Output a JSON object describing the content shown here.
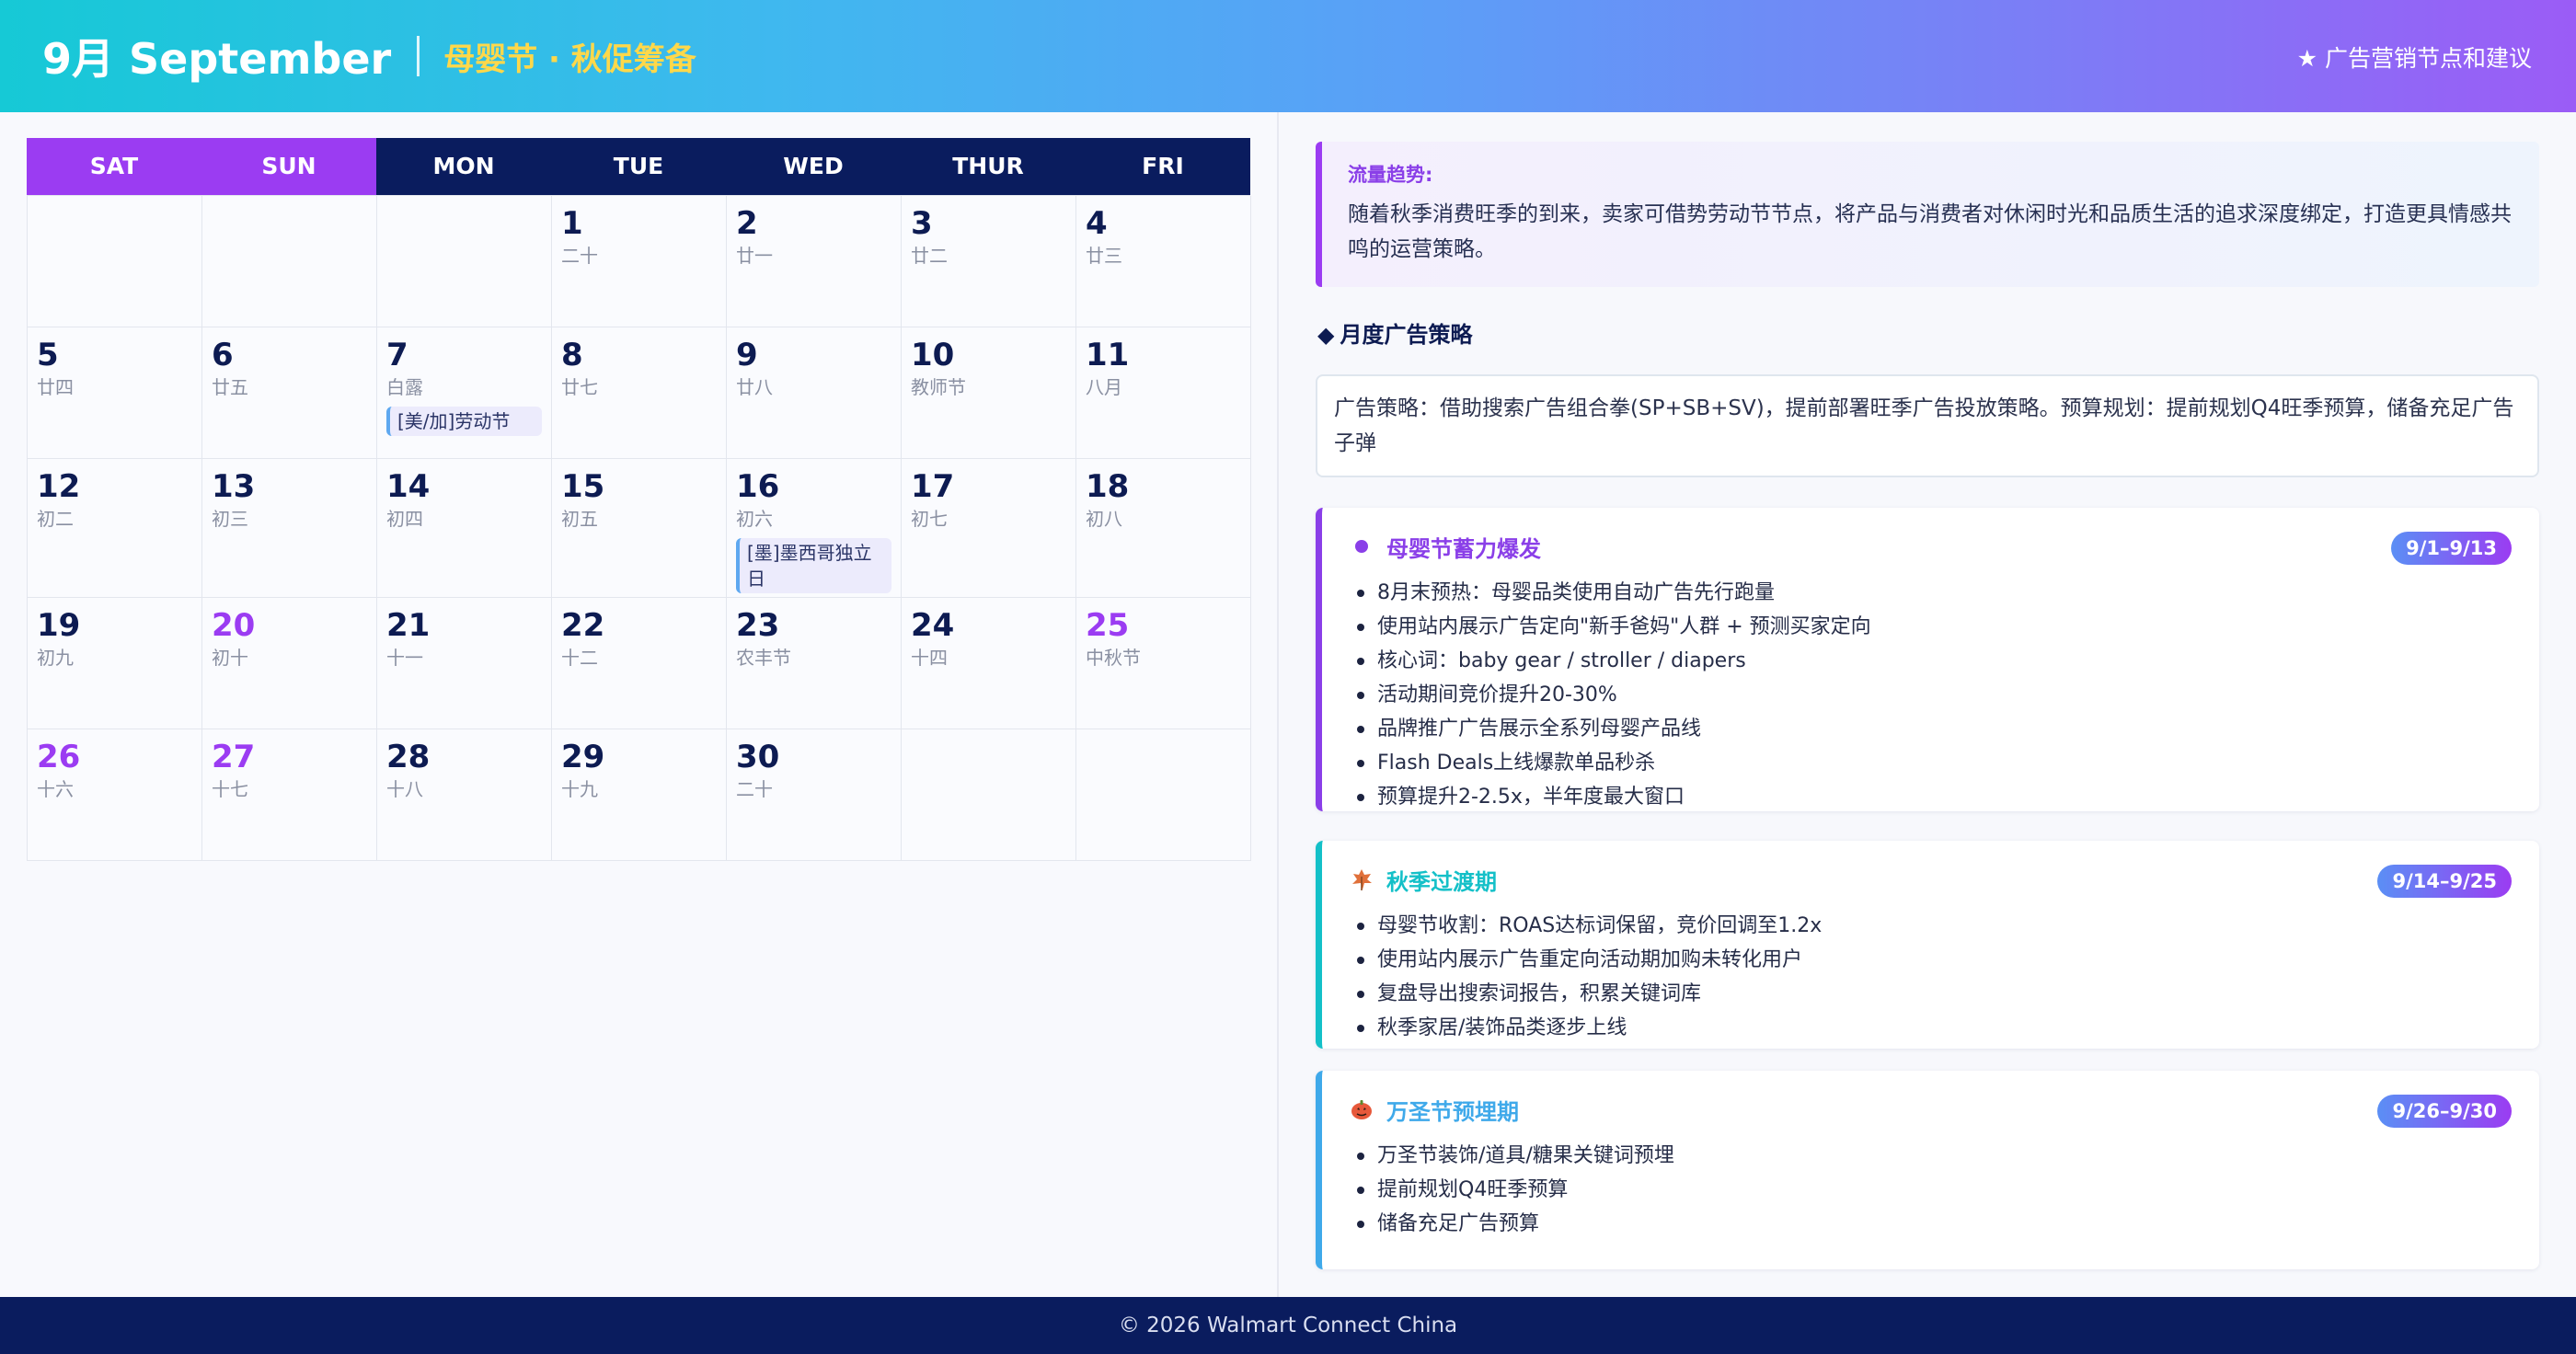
{
  "header": {
    "month": "9月 September",
    "theme": "母婴节 · 秋促筹备",
    "right_label": "★ 广告营销节点和建议"
  },
  "calendar": {
    "weekdays": [
      "SAT",
      "SUN",
      "MON",
      "TUE",
      "WED",
      "THUR",
      "FRI"
    ],
    "weeks": [
      [
        {
          "day": "",
          "lunar": ""
        },
        {
          "day": "",
          "lunar": ""
        },
        {
          "day": "",
          "lunar": ""
        },
        {
          "day": "1",
          "lunar": "二十"
        },
        {
          "day": "2",
          "lunar": "廿一"
        },
        {
          "day": "3",
          "lunar": "廿二"
        },
        {
          "day": "4",
          "lunar": "廿三"
        }
      ],
      [
        {
          "day": "5",
          "lunar": "廿四"
        },
        {
          "day": "6",
          "lunar": "廿五"
        },
        {
          "day": "7",
          "lunar": "白露",
          "event": "[美/加]劳动节"
        },
        {
          "day": "8",
          "lunar": "廿七"
        },
        {
          "day": "9",
          "lunar": "廿八"
        },
        {
          "day": "10",
          "lunar": "教师节"
        },
        {
          "day": "11",
          "lunar": "八月"
        }
      ],
      [
        {
          "day": "12",
          "lunar": "初二"
        },
        {
          "day": "13",
          "lunar": "初三"
        },
        {
          "day": "14",
          "lunar": "初四"
        },
        {
          "day": "15",
          "lunar": "初五"
        },
        {
          "day": "16",
          "lunar": "初六",
          "event": "[墨]墨西哥独立日"
        },
        {
          "day": "17",
          "lunar": "初七"
        },
        {
          "day": "18",
          "lunar": "初八"
        }
      ],
      [
        {
          "day": "19",
          "lunar": "初九"
        },
        {
          "day": "20",
          "lunar": "初十",
          "highlight": true
        },
        {
          "day": "21",
          "lunar": "十一"
        },
        {
          "day": "22",
          "lunar": "十二"
        },
        {
          "day": "23",
          "lunar": "农丰节"
        },
        {
          "day": "24",
          "lunar": "十四"
        },
        {
          "day": "25",
          "lunar": "中秋节",
          "highlight": true
        }
      ],
      [
        {
          "day": "26",
          "lunar": "十六",
          "highlight": true
        },
        {
          "day": "27",
          "lunar": "十七",
          "highlight": true
        },
        {
          "day": "28",
          "lunar": "十八"
        },
        {
          "day": "29",
          "lunar": "十九"
        },
        {
          "day": "30",
          "lunar": "二十"
        },
        {
          "day": "",
          "lunar": ""
        },
        {
          "day": "",
          "lunar": ""
        }
      ]
    ]
  },
  "trend": {
    "title": "流量趋势:",
    "text": "随着秋季消费旺季的到来，卖家可借势劳动节节点，将产品与消费者对休闲时光和品质生活的追求深度绑定，打造更具情感共鸣的运营策略。"
  },
  "monthly": {
    "title": "月度广告策略",
    "text": "广告策略：借助搜索广告组合拳(SP+SB+SV)，提前部署旺季广告投放策略。预算规划：提前规划Q4旺季预算，储备充足广告子弹"
  },
  "cards": [
    {
      "title": "母婴节蓄力爆发",
      "badge": "9/1–9/13",
      "icon": "dot-icon",
      "color": "#8a3fe8",
      "items": [
        "8月末预热：母婴品类使用自动广告先行跑量",
        "使用站内展示广告定向\"新手爸妈\"人群 + 预测买家定向",
        "核心词：baby gear / stroller / diapers",
        "活动期间竞价提升20-30%",
        "品牌推广广告展示全系列母婴产品线",
        "Flash Deals上线爆款单品秒杀",
        "预算提升2-2.5x，半年度最大窗口"
      ]
    },
    {
      "title": "秋季过渡期",
      "badge": "9/14–9/25",
      "icon": "maple-leaf-icon",
      "color": "#14c0c8",
      "items": [
        "母婴节收割：ROAS达标词保留，竞价回调至1.2x",
        "使用站内展示广告重定向活动期加购未转化用户",
        "复盘导出搜索词报告，积累关键词库",
        "秋季家居/装饰品类逐步上线"
      ]
    },
    {
      "title": "万圣节预埋期",
      "badge": "9/26–9/30",
      "icon": "pumpkin-icon",
      "color": "#3fa9ea",
      "items": [
        "万圣节装饰/道具/糖果关键词预埋",
        "提前规划Q4旺季预算",
        "储备充足广告预算"
      ]
    }
  ],
  "footer": {
    "text": "© 2026 Walmart Connect China"
  }
}
